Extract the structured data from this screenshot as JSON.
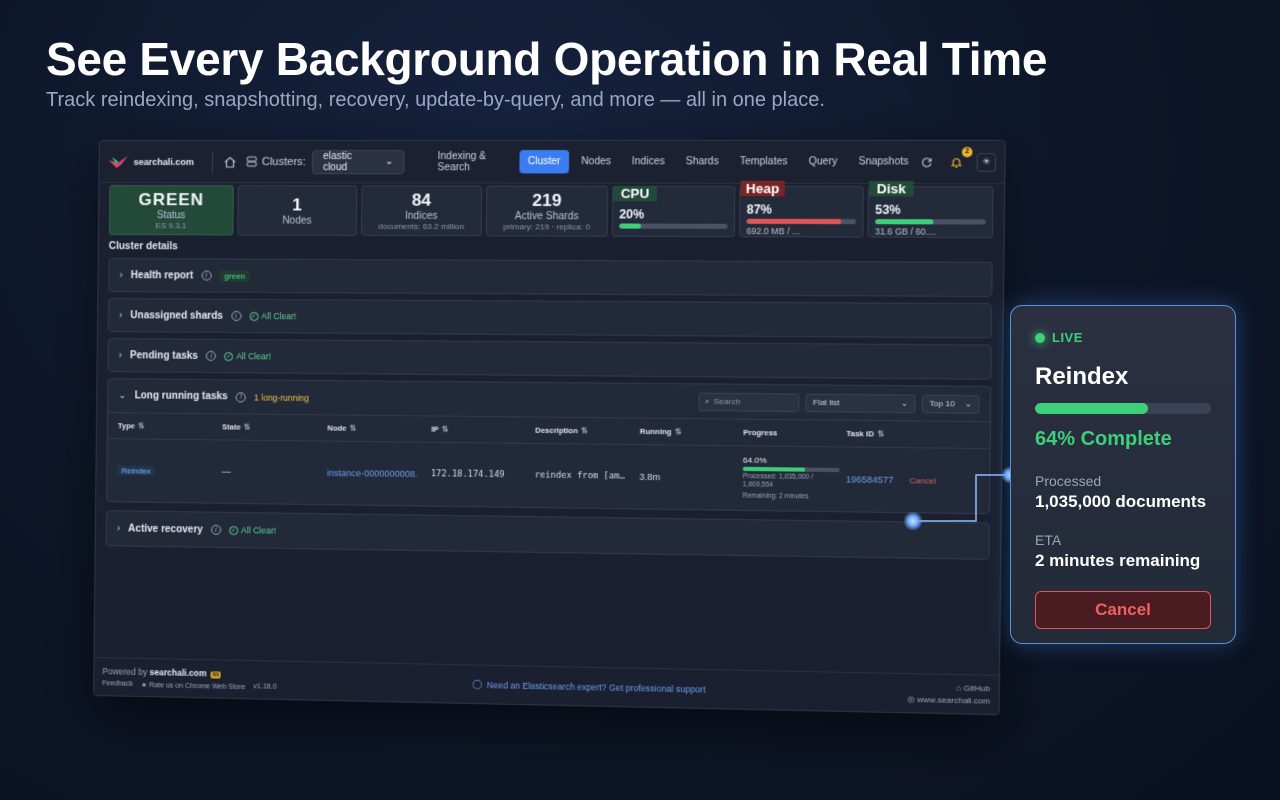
{
  "hero": {
    "title": "See Every Background Operation in Real Time",
    "subtitle": "Track reindexing, snapshotting, recovery, update-by-query, and more — all in one place."
  },
  "topbar": {
    "brand": "searchali.com",
    "clusters_label": "Clusters:",
    "cluster_selected": "elastic cloud",
    "nav": [
      "Indexing & Search",
      "Cluster",
      "Nodes",
      "Indices",
      "Shards",
      "Templates",
      "Query",
      "Snapshots"
    ],
    "active_nav": "Cluster",
    "notifications_count": "2"
  },
  "stats": {
    "status": {
      "value": "GREEN",
      "label": "Status",
      "version": "ES 9.3.1"
    },
    "nodes": {
      "value": "1",
      "label": "Nodes"
    },
    "indices": {
      "value": "84",
      "label": "Indices",
      "detail": "documents: 63.2 million"
    },
    "shards": {
      "value": "219",
      "label": "Active Shards",
      "detail": "primary: 219 · replica: 0"
    },
    "cpu": {
      "label": "CPU",
      "pct": "20%",
      "fraction": 0.2,
      "color": "#3ecf7a"
    },
    "heap": {
      "label": "Heap",
      "pct": "87%",
      "fraction": 0.87,
      "detail": "692.0 MB / ...",
      "color": "#e05555"
    },
    "disk": {
      "label": "Disk",
      "pct": "53%",
      "fraction": 0.53,
      "detail": "31.6 GB / 60....",
      "color": "#3ecf7a"
    }
  },
  "cluster_details": {
    "title": "Cluster details",
    "health": {
      "title": "Health report",
      "tag": "green"
    },
    "unassigned": {
      "title": "Unassigned shards",
      "status": "All Clear!"
    },
    "pending": {
      "title": "Pending tasks",
      "status": "All Clear!"
    },
    "long_running": {
      "title": "Long running tasks",
      "count": "1 long-running",
      "search_placeholder": "Search",
      "view": "Flat list",
      "limit": "Top 10",
      "columns": [
        "Type",
        "State",
        "Node",
        "IP",
        "Description",
        "Running",
        "Progress",
        "Task ID",
        ""
      ],
      "row": {
        "type": "Reindex",
        "state": "—",
        "node": "instance-0000000008.",
        "ip": "172.18.174.149",
        "description": "reindex from [am…",
        "running": "3.8m",
        "progress_pct": "64.0%",
        "progress_fraction": 0.64,
        "processed": "Processed: 1,035,000 / 1,609,554",
        "remaining": "Remaining: 2 minutes",
        "task_id": "196584577",
        "action": "Cancel"
      }
    },
    "recovery": {
      "title": "Active recovery",
      "status": "All Clear!"
    }
  },
  "footer": {
    "powered_by": "Powered by",
    "brand": "searchali.com",
    "li": "in",
    "feedback": "Feedback",
    "rate": "Rate us on Chrome Web Store",
    "version": "v1.18.0",
    "support": "Need an Elasticsearch expert? Get professional support",
    "github": "GitHub",
    "site": "www.searchali.com"
  },
  "live_card": {
    "badge": "LIVE",
    "title": "Reindex",
    "fraction": 0.64,
    "complete": "64% Complete",
    "processed_label": "Processed",
    "processed_value": "1,035,000 documents",
    "eta_label": "ETA",
    "eta_value": "2 minutes remaining",
    "cancel": "Cancel"
  }
}
